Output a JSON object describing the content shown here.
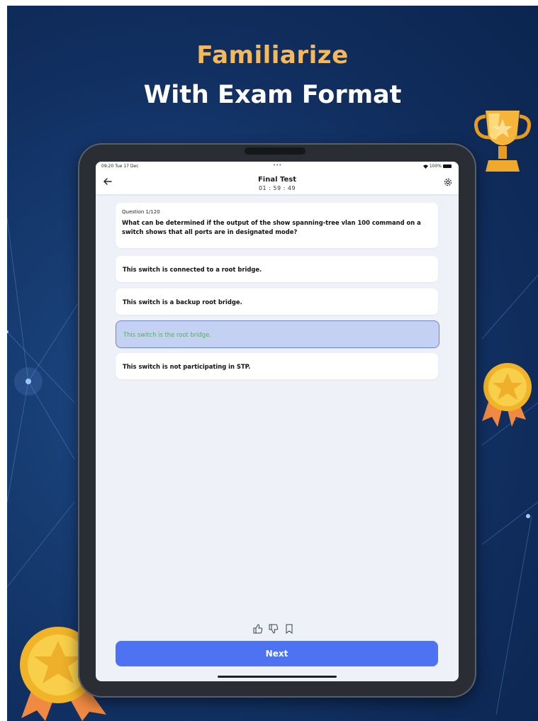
{
  "headline": {
    "line1": "Familiarize",
    "line2": "With Exam Format"
  },
  "status_bar": {
    "time": "09:20  Tue 17 Dec",
    "dots": "•••",
    "battery": "100%"
  },
  "nav": {
    "back_icon": "arrow-left-icon",
    "title": "Final Test",
    "timer": "01 : 59 : 49",
    "settings_icon": "gear-icon"
  },
  "question": {
    "number": "Question 1/120",
    "text": "What can be determined if the output of the show spanning-tree vlan 100 command on a switch shows that all ports are in designated mode?"
  },
  "options": [
    {
      "label": "This switch is connected to a root bridge.",
      "selected": false
    },
    {
      "label": "This switch is a backup root bridge.",
      "selected": false
    },
    {
      "label": "This switch is the root bridge.",
      "selected": true
    },
    {
      "label": "This switch is not participating in STP.",
      "selected": false
    }
  ],
  "feedback_icons": [
    "thumbs-up-icon",
    "thumbs-down-icon",
    "bookmark-icon"
  ],
  "next_button": {
    "label": "Next"
  },
  "colors": {
    "background": "#163a70",
    "accent": "#4d72f2",
    "headline_accent": "#f6b95a",
    "selected_fill": "#c5d1f3",
    "selected_text": "#5aa86f"
  }
}
